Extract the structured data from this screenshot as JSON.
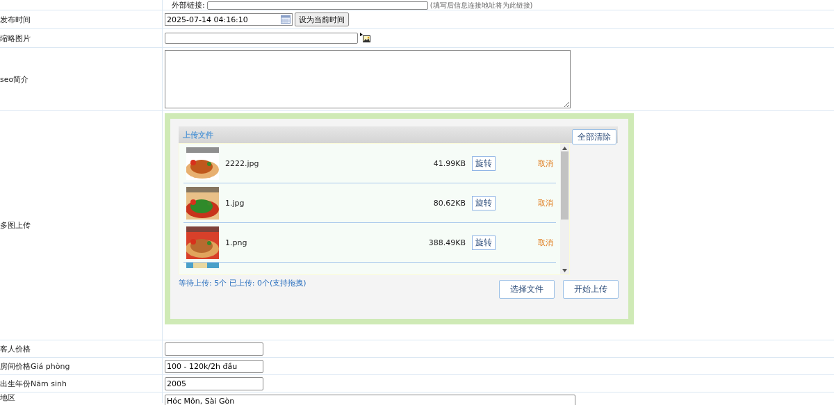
{
  "top_row": {
    "label": "外部链接:",
    "hint": "(填写后信息连接地址将为此链接)"
  },
  "publish_time": {
    "label": "发布时间",
    "value": "2025-07-14 04:16:10",
    "button": "设为当前时间"
  },
  "thumbnail": {
    "label": "缩略图片"
  },
  "seo": {
    "label": "seo简介"
  },
  "multi_upload": {
    "label": "多图上传",
    "title": "上传文件",
    "clear_all": "全部清除",
    "files": [
      {
        "name": "2222.jpg",
        "size": "41.99KB",
        "rotate": "旋转",
        "cancel": "取消",
        "kind": "picture"
      },
      {
        "name": "1.jpg",
        "size": "80.62KB",
        "rotate": "旋转",
        "cancel": "取消",
        "kind": "picture"
      },
      {
        "name": "1.png",
        "size": "388.49KB",
        "rotate": "旋转",
        "cancel": "取消",
        "kind": "picture"
      }
    ],
    "status": "等待上传: 5个 已上传: 0个(支持拖拽)",
    "choose": "选择文件",
    "start": "开始上传"
  },
  "fields": [
    {
      "label": "客人价格"
    },
    {
      "label": "房间价格Giá phòng",
      "value": "100 - 120k/2h đầu"
    },
    {
      "label": "出生年份Năm sinh",
      "value": "2005"
    }
  ],
  "region": {
    "label": "地区",
    "value": "Hóc Môn, Sài Gòn"
  }
}
